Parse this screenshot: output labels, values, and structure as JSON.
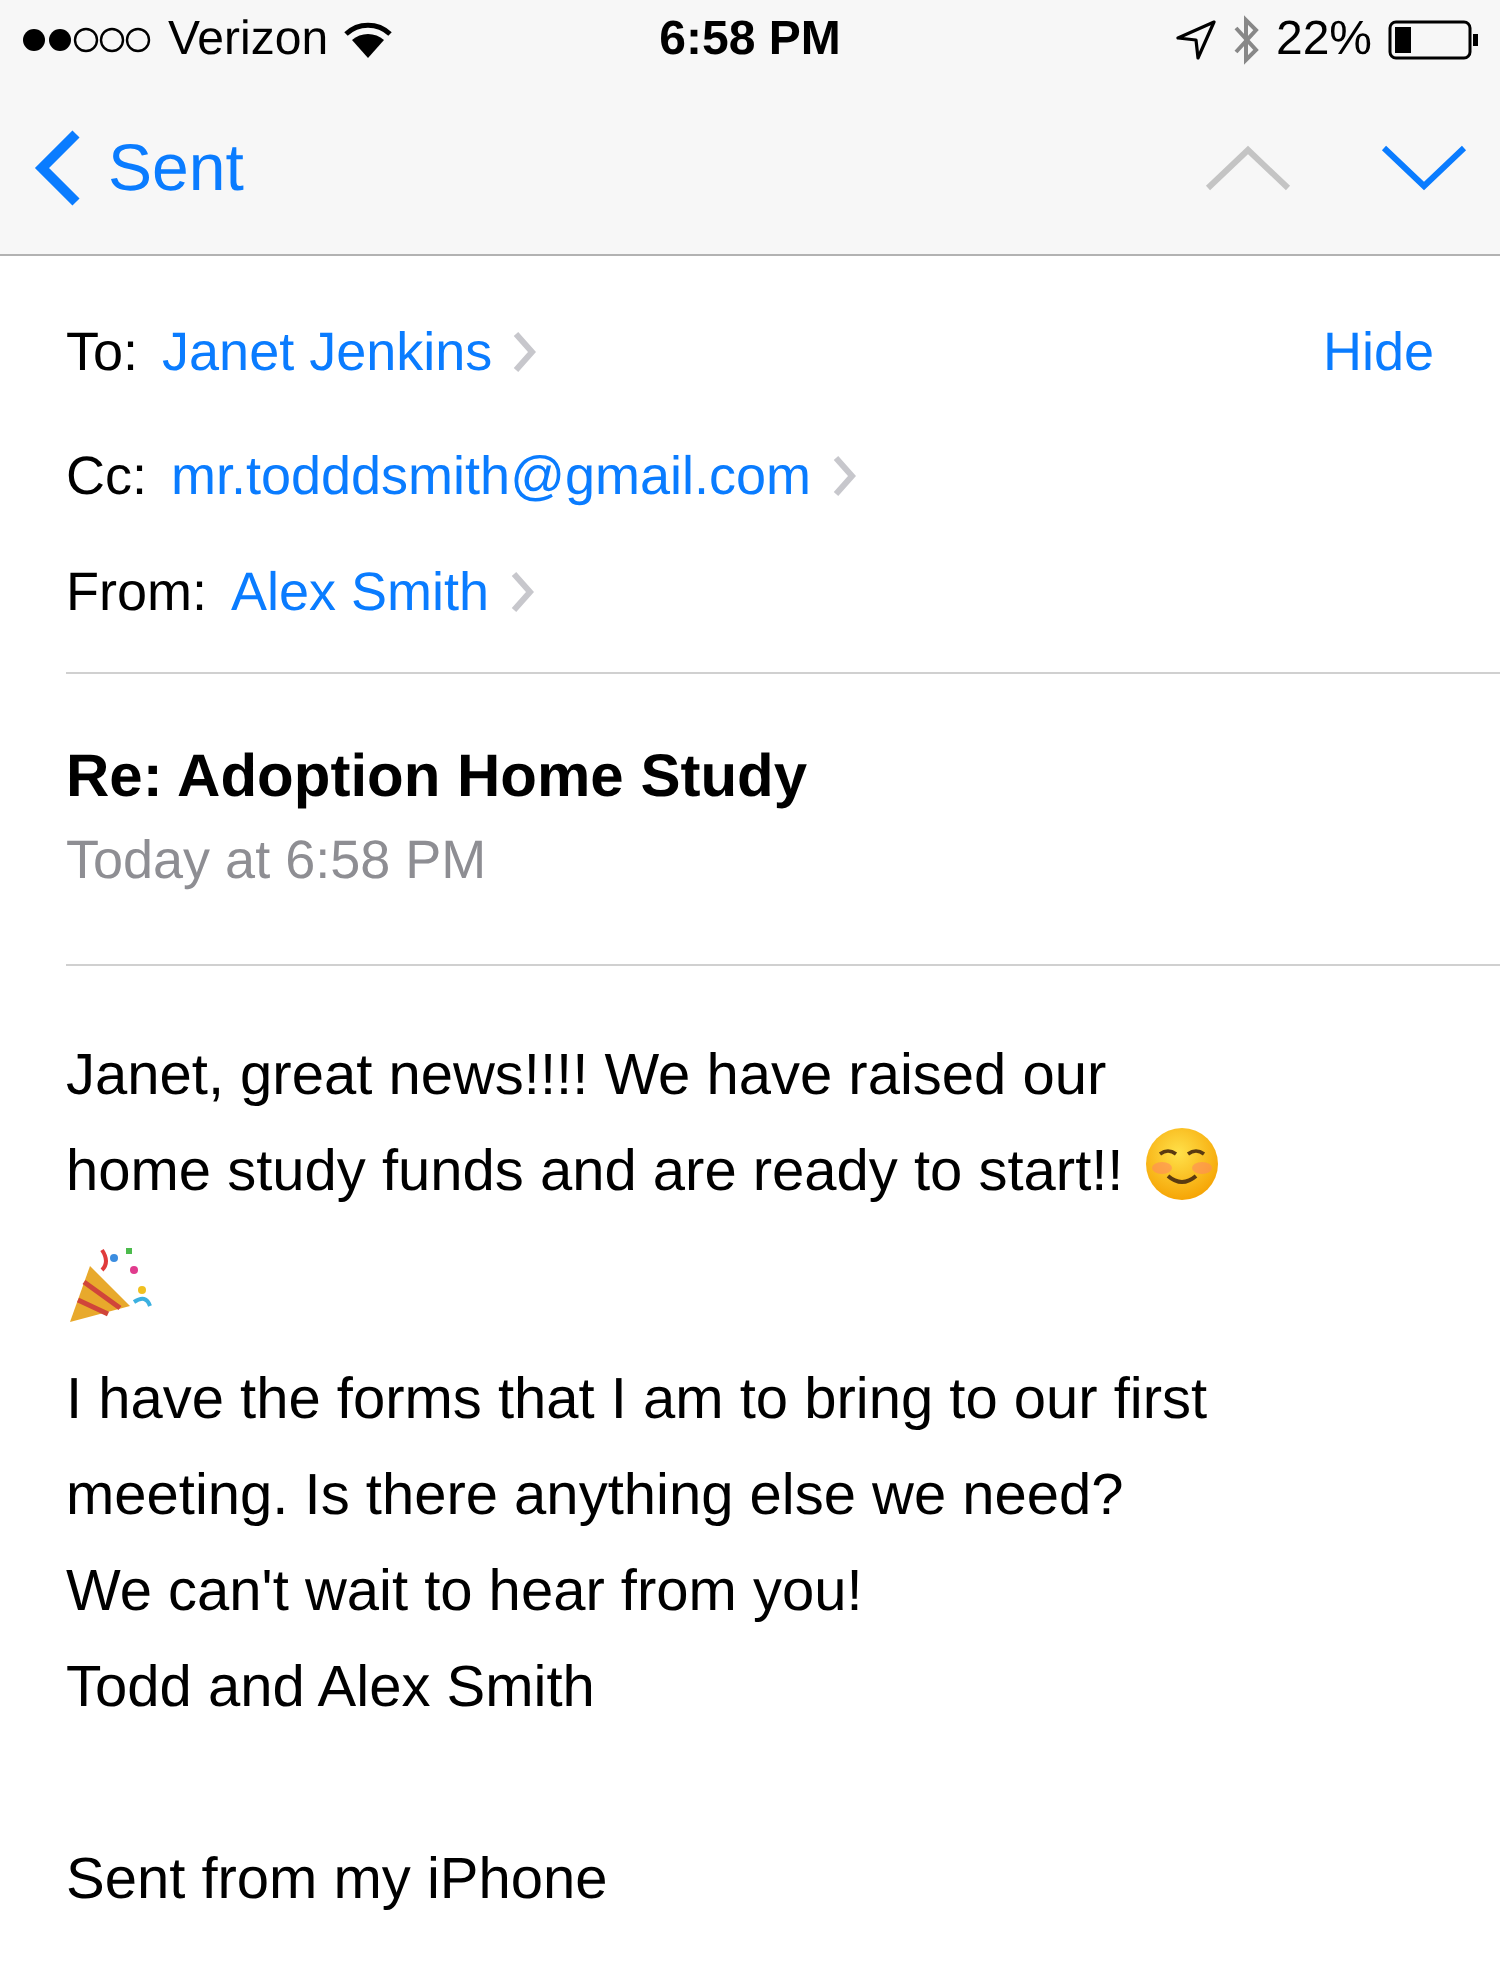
{
  "status_bar": {
    "carrier": "Verizon",
    "time": "6:58 PM",
    "battery": "22%"
  },
  "nav": {
    "back": "Sent",
    "up_disabled": true,
    "down_disabled": false
  },
  "header": {
    "recipients": [
      {
        "label": "To:",
        "name": "Janet Jenkins"
      },
      {
        "label": "Cc:",
        "name": "mr.todddsmith@gmail.com"
      },
      {
        "label": "From:",
        "name": "Alex Smith"
      }
    ],
    "hide": "Hide",
    "subject": "Re: Adoption Home Study",
    "date": "Today at 6:58 PM"
  },
  "body": [
    {
      "kind": "line",
      "text": "Janet, great news!!!! We have raised our"
    },
    {
      "kind": "line",
      "text": "home study funds and are ready to start!!",
      "smiley": true
    },
    {
      "kind": "emoji"
    },
    {
      "kind": "line",
      "text": "I have the forms that I am to bring to our first"
    },
    {
      "kind": "line",
      "text": "meeting. Is there anything else we need?"
    },
    {
      "kind": "line",
      "text": "We can't wait to hear from you!"
    },
    {
      "kind": "line",
      "text": "Todd and Alex Smith"
    },
    {
      "kind": "blank"
    },
    {
      "kind": "line",
      "text": "Sent from my iPhone"
    }
  ]
}
